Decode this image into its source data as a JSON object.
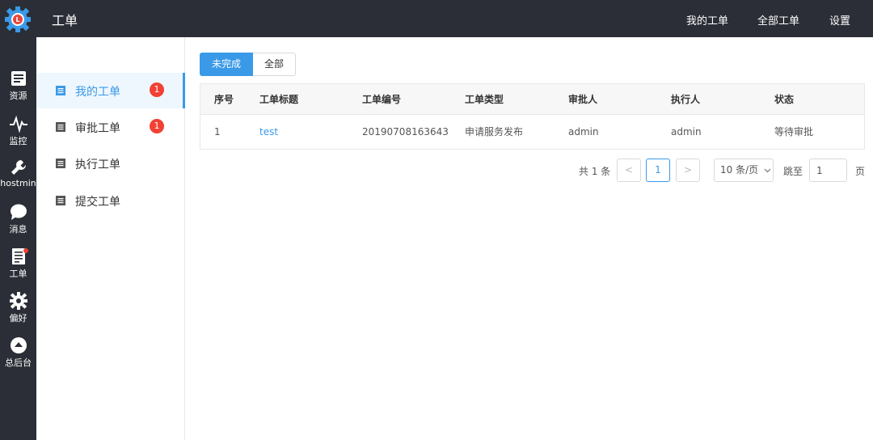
{
  "colors": {
    "accent": "#3a9ae8",
    "badge": "#f04134",
    "dark": "#2b2e36"
  },
  "rail": {
    "items": [
      {
        "label": "资源",
        "icon": "resource-icon"
      },
      {
        "label": "监控",
        "icon": "pulse-icon"
      },
      {
        "label": "hostmin",
        "icon": "wrench-icon"
      },
      {
        "label": "消息",
        "icon": "chat-bubble-icon"
      },
      {
        "label": "工单",
        "icon": "document-icon"
      },
      {
        "label": "偏好",
        "icon": "gear-icon"
      },
      {
        "label": "总后台",
        "icon": "up-arrow-circle-icon"
      }
    ]
  },
  "topbar": {
    "title": "工单",
    "nav": [
      "我的工单",
      "全部工单",
      "设置"
    ]
  },
  "sidemenu": {
    "items": [
      {
        "label": "我的工单",
        "badge": "1"
      },
      {
        "label": "审批工单",
        "badge": "1"
      },
      {
        "label": "执行工单"
      },
      {
        "label": "提交工单"
      }
    ]
  },
  "tabs": [
    "未完成",
    "全部"
  ],
  "table": {
    "columns": [
      "序号",
      "工单标题",
      "工单编号",
      "工单类型",
      "审批人",
      "执行人",
      "状态"
    ],
    "rows": [
      [
        "1",
        "test",
        "20190708163643",
        "申请服务发布",
        "admin",
        "admin",
        "等待审批"
      ]
    ]
  },
  "pagination": {
    "total": "共 1 条",
    "prev": "<",
    "current": "1",
    "next": ">",
    "page_size": "10 条/页",
    "jump_label": "跳至",
    "jump_value": "1",
    "page_label": "页"
  }
}
